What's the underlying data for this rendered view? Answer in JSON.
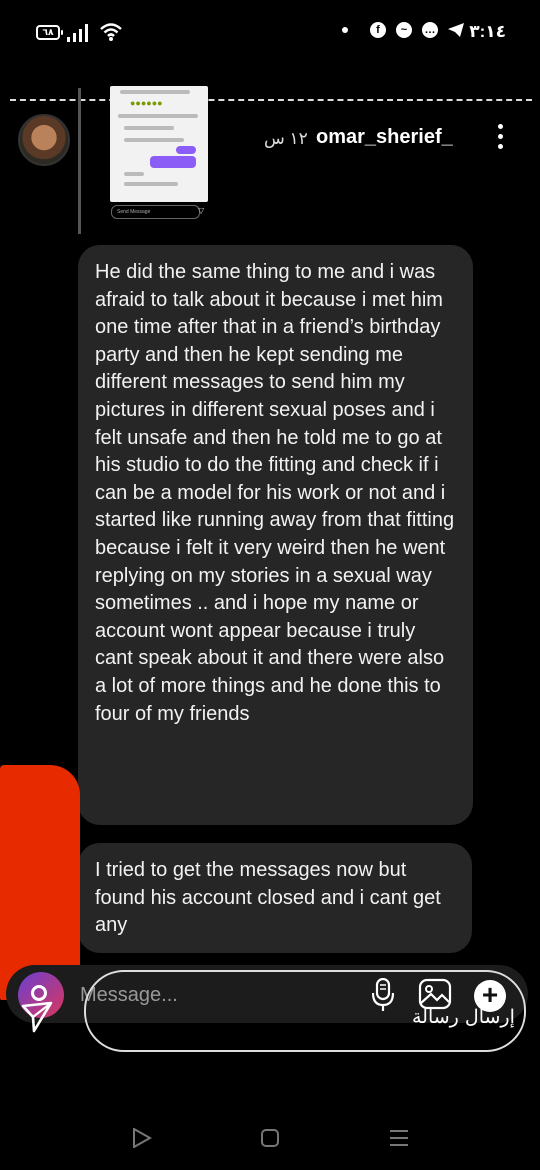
{
  "status_bar": {
    "battery": "٦٨",
    "time": "٣:١٤"
  },
  "story": {
    "thumbnail_input_placeholder": "Send Message"
  },
  "header": {
    "username": "omar_sherief_",
    "time_ago": "١٢ س"
  },
  "messages": [
    {
      "text": "He did the same thing to me and i was afraid to talk about it because i met him one time after that in a friend’s birthday party and then he kept sending me different messages to send him my pictures in different sexual poses and i felt unsafe and then he told me to go at his studio to do the fitting and check if i can be a model for his work or not and i started like running away from that fitting because i felt it very weird then he went replying on my stories in a sexual way sometimes .. and i hope my name or account wont appear because i truly cant speak about it and there were also a lot of more things and he done this to four of my friends"
    },
    {
      "text": "I tried to get the messages now but found his account closed and i cant get any"
    }
  ],
  "composer": {
    "placeholder": "Message...",
    "send_label": "إرسال رسالة"
  },
  "icons": {
    "camera": "camera-icon",
    "mic": "microphone-icon",
    "gallery": "gallery-icon",
    "plus": "plus-icon",
    "send": "send-arrow-icon"
  },
  "colors": {
    "bubble": "#262626",
    "background": "#000000",
    "redaction": "#e82a00"
  }
}
